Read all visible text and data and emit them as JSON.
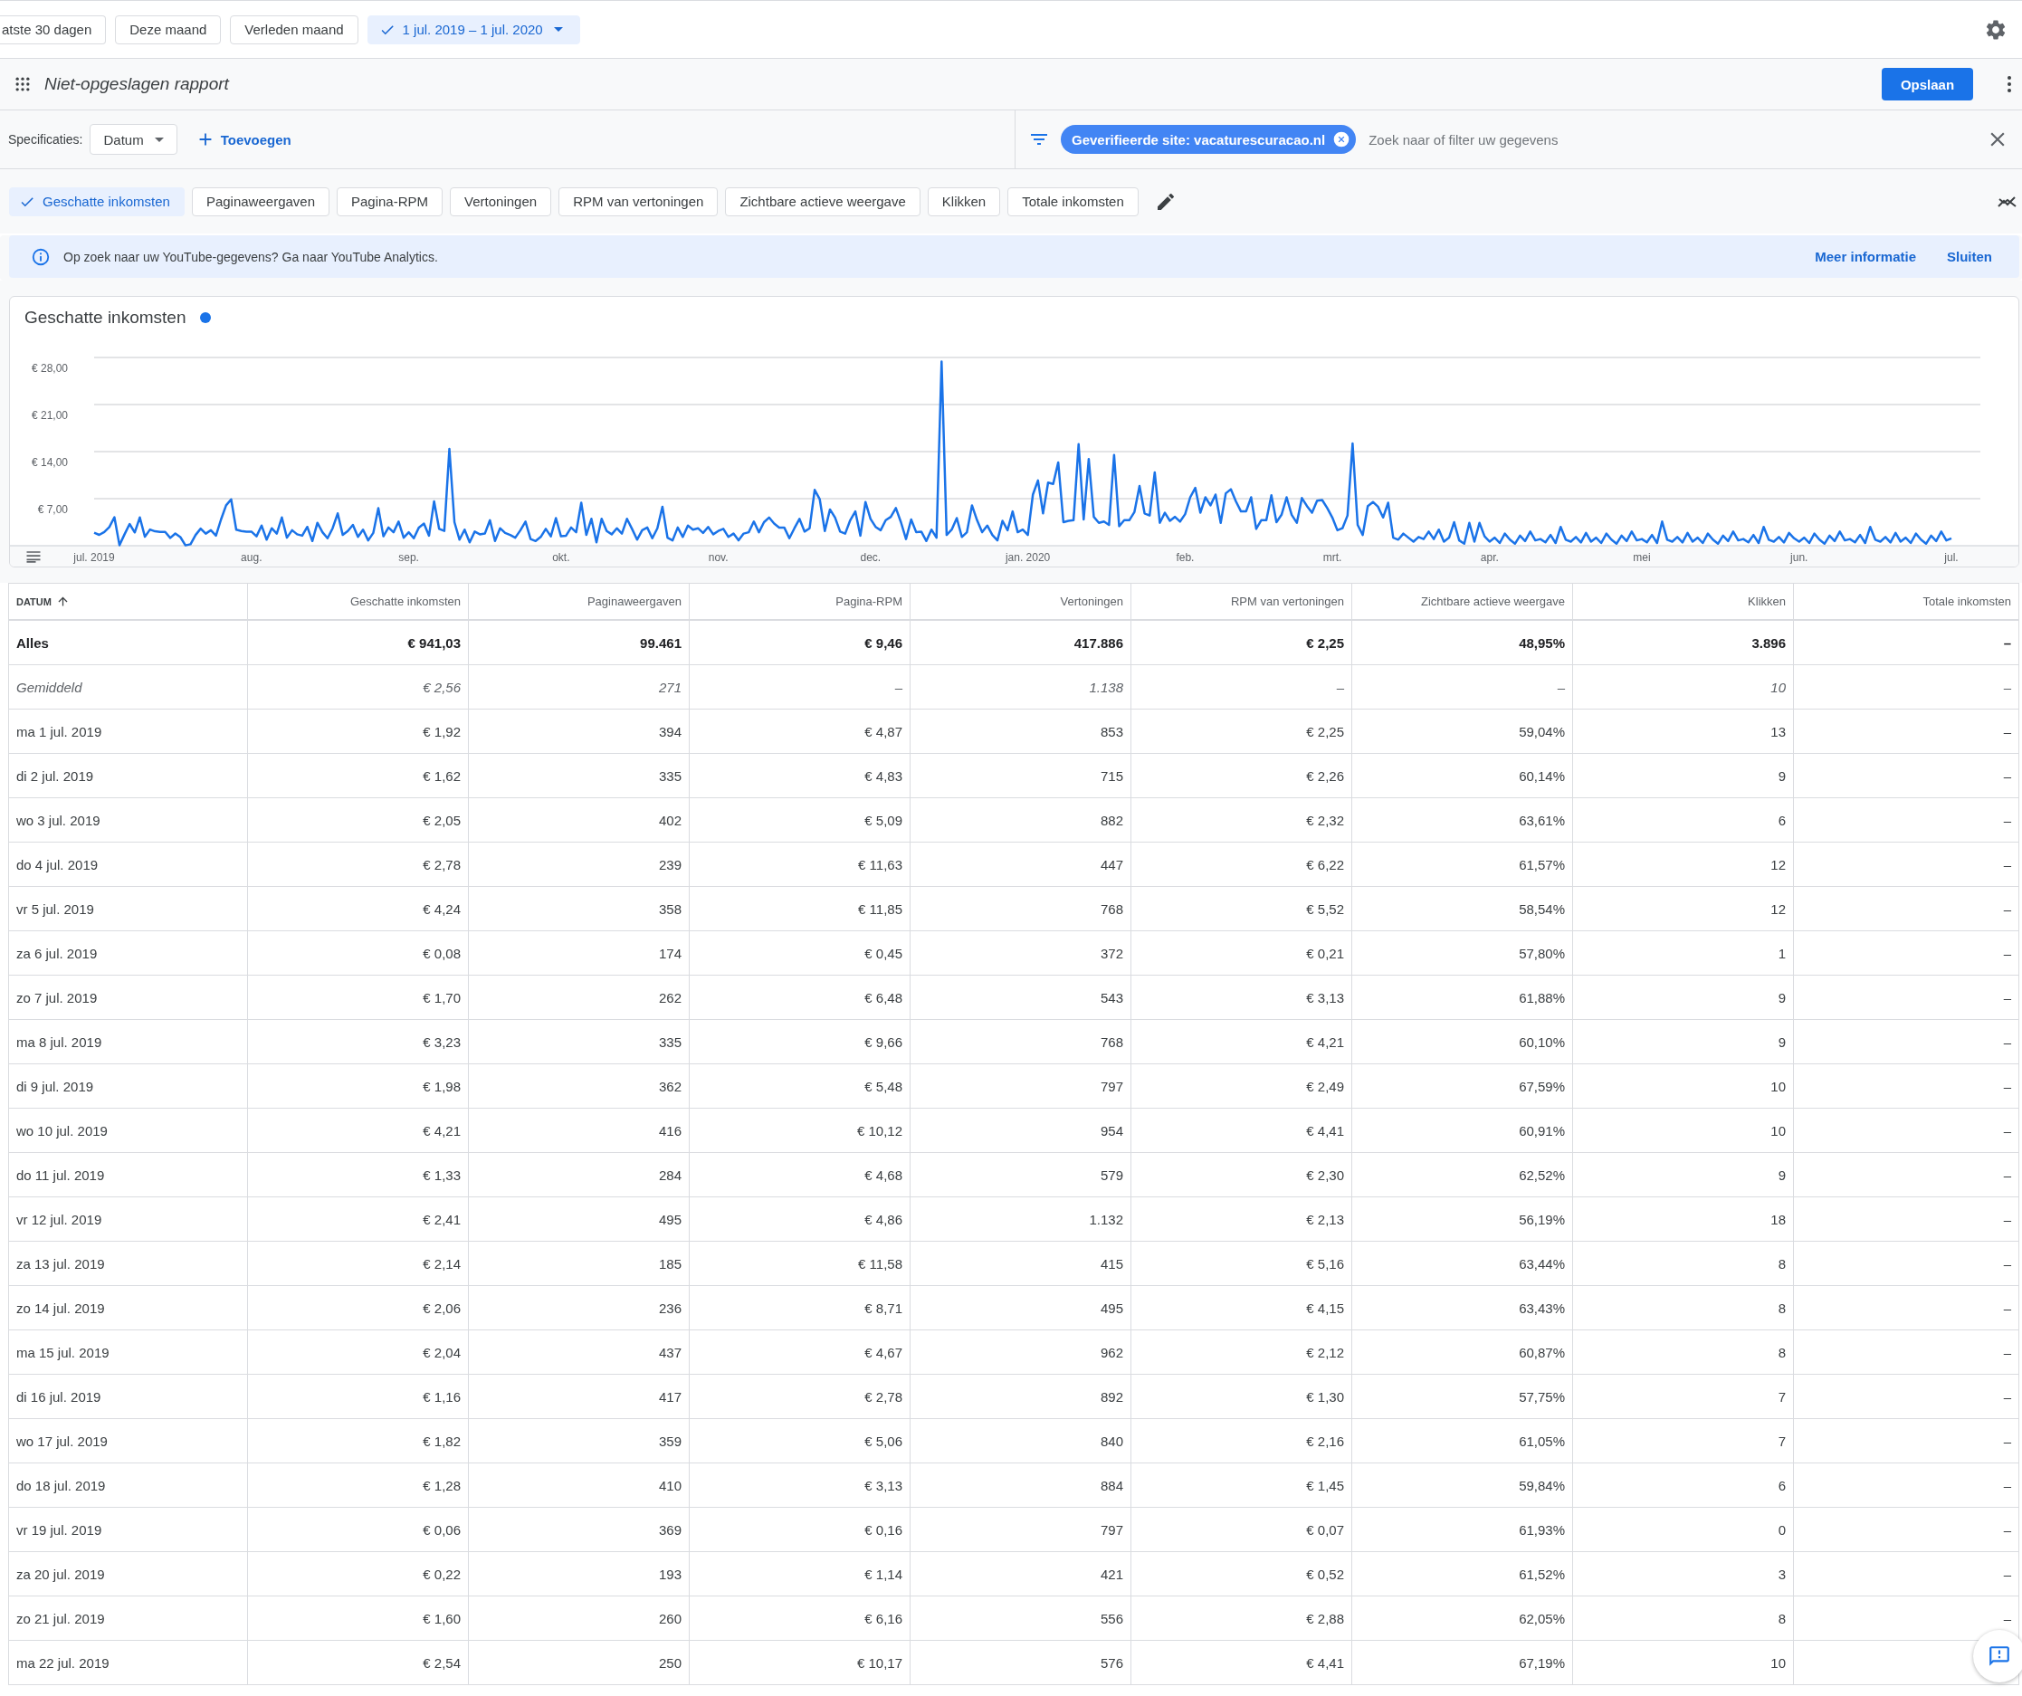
{
  "date_presets": [
    {
      "label": "atste 30 dagen",
      "selected": false
    },
    {
      "label": "Deze maand",
      "selected": false
    },
    {
      "label": "Verleden maand",
      "selected": false
    },
    {
      "label": "1 jul. 2019 – 1 jul. 2020",
      "selected": true
    }
  ],
  "report": {
    "title": "Niet-opgeslagen rapport",
    "save_button": "Opslaan"
  },
  "dimensions": {
    "label": "Specificaties:",
    "value": "Datum",
    "add_button": "Toevoegen"
  },
  "filter": {
    "chips": [
      {
        "label": "Geverifieerde site: vacaturescuracao.nl"
      }
    ],
    "placeholder": "Zoek naar of filter uw gegevens"
  },
  "metrics": [
    {
      "label": "Geschatte inkomsten",
      "selected": true
    },
    {
      "label": "Paginaweergaven",
      "selected": false
    },
    {
      "label": "Pagina-RPM",
      "selected": false
    },
    {
      "label": "Vertoningen",
      "selected": false
    },
    {
      "label": "RPM van vertoningen",
      "selected": false
    },
    {
      "label": "Zichtbare actieve weergave",
      "selected": false
    },
    {
      "label": "Klikken",
      "selected": false
    },
    {
      "label": "Totale inkomsten",
      "selected": false
    }
  ],
  "banner": {
    "text": "Op zoek naar uw YouTube-gegevens? Ga naar YouTube Analytics.",
    "links": [
      "Meer informatie",
      "Sluiten"
    ]
  },
  "chart": {
    "chart_data": {
      "type": "line",
      "ylim": [
        0,
        28
      ],
      "grid": true,
      "categories": [
        "jul. 2019",
        null,
        null,
        null,
        null,
        null,
        null,
        null,
        null,
        null,
        null,
        null,
        null,
        null,
        null,
        null,
        null,
        null,
        null,
        null,
        null,
        null,
        null,
        null,
        null,
        null,
        null,
        null,
        null,
        null,
        null,
        "aug.",
        null,
        null,
        null,
        null,
        null,
        null,
        null,
        null,
        null,
        null,
        null,
        null,
        null,
        null,
        null,
        null,
        null,
        null,
        null,
        null,
        null,
        null,
        null,
        null,
        null,
        null,
        null,
        null,
        null,
        null,
        "sep.",
        null,
        null,
        null,
        null,
        null,
        null,
        null,
        null,
        null,
        null,
        null,
        null,
        null,
        null,
        null,
        null,
        null,
        null,
        null,
        null,
        null,
        null,
        null,
        null,
        null,
        null,
        null,
        null,
        null,
        "okt.",
        null,
        null,
        null,
        null,
        null,
        null,
        null,
        null,
        null,
        null,
        null,
        null,
        null,
        null,
        null,
        null,
        null,
        null,
        null,
        null,
        null,
        null,
        null,
        null,
        null,
        null,
        null,
        null,
        null,
        null,
        "nov.",
        null,
        null,
        null,
        null,
        null,
        null,
        null,
        null,
        null,
        null,
        null,
        null,
        null,
        null,
        null,
        null,
        null,
        null,
        null,
        null,
        null,
        null,
        null,
        null,
        null,
        null,
        null,
        null,
        null,
        "dec.",
        null,
        null,
        null,
        null,
        null,
        null,
        null,
        null,
        null,
        null,
        null,
        null,
        null,
        null,
        null,
        null,
        null,
        null,
        null,
        null,
        null,
        null,
        null,
        null,
        null,
        null,
        null,
        null,
        null,
        null,
        "jan. 2020",
        null,
        null,
        null,
        null,
        null,
        null,
        null,
        null,
        null,
        null,
        null,
        null,
        null,
        null,
        null,
        null,
        null,
        null,
        null,
        null,
        null,
        null,
        null,
        null,
        null,
        null,
        null,
        null,
        null,
        null,
        "feb.",
        null,
        null,
        null,
        null,
        null,
        null,
        null,
        null,
        null,
        null,
        null,
        null,
        null,
        null,
        null,
        null,
        null,
        null,
        null,
        null,
        null,
        null,
        null,
        null,
        null,
        null,
        null,
        null,
        "mrt.",
        null,
        null,
        null,
        null,
        null,
        null,
        null,
        null,
        null,
        null,
        null,
        null,
        null,
        null,
        null,
        null,
        null,
        null,
        null,
        null,
        null,
        null,
        null,
        null,
        null,
        null,
        null,
        null,
        null,
        null,
        "apr.",
        null,
        null,
        null,
        null,
        null,
        null,
        null,
        null,
        null,
        null,
        null,
        null,
        null,
        null,
        null,
        null,
        null,
        null,
        null,
        null,
        null,
        null,
        null,
        null,
        null,
        null,
        null,
        null,
        null,
        "mei",
        null,
        null,
        null,
        null,
        null,
        null,
        null,
        null,
        null,
        null,
        null,
        null,
        null,
        null,
        null,
        null,
        null,
        null,
        null,
        null,
        null,
        null,
        null,
        null,
        null,
        null,
        null,
        null,
        null,
        null,
        "jun.",
        null,
        null,
        null,
        null,
        null,
        null,
        null,
        null,
        null,
        null,
        null,
        null,
        null,
        null,
        null,
        null,
        null,
        null,
        null,
        null,
        null,
        null,
        null,
        null,
        null,
        null,
        null,
        null,
        null,
        "jul."
      ],
      "yticks": [
        {
          "value": 7,
          "label": "€ 7,00"
        },
        {
          "value": 14,
          "label": "€ 14,00"
        },
        {
          "value": 21,
          "label": "€ 21,00"
        },
        {
          "value": 28,
          "label": "€ 28,00"
        }
      ],
      "series": [
        {
          "name": "Geschatte inkomsten",
          "color": "#1a73e8",
          "values": [
            1.92,
            1.62,
            2.05,
            2.78,
            4.24,
            0.08,
            1.7,
            3.23,
            1.98,
            4.21,
            1.33,
            2.41,
            2.14,
            2.06,
            2.04,
            1.16,
            1.82,
            1.28,
            0.06,
            0.22,
            1.6,
            2.54,
            1.8,
            2.3,
            1.5,
            3.9,
            6.0,
            6.9,
            2.4,
            2.2,
            2.1,
            2.1,
            1.4,
            3.0,
            0.9,
            2.6,
            1.8,
            4.2,
            1.2,
            2.3,
            1.7,
            1.5,
            2.8,
            0.7,
            3.4,
            2.0,
            1.1,
            2.6,
            4.8,
            1.6,
            2.2,
            3.1,
            1.3,
            2.4,
            0.8,
            1.9,
            5.6,
            1.4,
            2.7,
            2.0,
            3.6,
            1.2,
            2.0,
            1.1,
            2.7,
            3.3,
            1.5,
            6.6,
            2.5,
            2.2,
            14.4,
            3.5,
            0.9,
            2.4,
            0.5,
            2.1,
            1.7,
            1.8,
            3.8,
            0.7,
            2.6,
            1.9,
            1.6,
            1.2,
            2.3,
            3.6,
            1.0,
            0.7,
            1.3,
            2.5,
            1.4,
            4.1,
            1.4,
            1.5,
            2.7,
            2.0,
            6.4,
            1.6,
            4.0,
            0.5,
            4.0,
            2.2,
            1.7,
            2.6,
            1.8,
            4.0,
            2.5,
            0.9,
            2.3,
            2.7,
            1.1,
            2.6,
            5.8,
            1.2,
            0.8,
            2.7,
            1.3,
            3.0,
            2.4,
            2.6,
            1.9,
            2.8,
            1.7,
            2.2,
            2.5,
            1.3,
            1.8,
            0.8,
            1.8,
            2.0,
            3.6,
            2.0,
            3.5,
            4.2,
            3.3,
            2.7,
            2.7,
            1.1,
            2.6,
            4.0,
            2.1,
            2.6,
            8.3,
            6.9,
            2.2,
            5.4,
            4.2,
            2.1,
            1.8,
            3.8,
            5.1,
            1.5,
            6.5,
            4.0,
            2.8,
            2.3,
            3.8,
            4.3,
            5.6,
            3.5,
            1.0,
            3.9,
            2.0,
            2.1,
            0.7,
            2.4,
            1.2,
            27.4,
            1.6,
            2.4,
            4.1,
            1.3,
            2.0,
            6.0,
            3.8,
            2.0,
            3.0,
            1.6,
            0.8,
            3.7,
            2.3,
            5.1,
            2.0,
            2.4,
            1.6,
            7.6,
            9.7,
            4.8,
            9.4,
            9.2,
            12.4,
            3.5,
            3.7,
            3.8,
            15.1,
            3.9,
            12.9,
            4.3,
            3.4,
            3.6,
            3.1,
            13.5,
            2.9,
            3.8,
            3.8,
            5.0,
            8.9,
            4.8,
            4.5,
            10.9,
            3.4,
            4.9,
            3.7,
            4.3,
            3.6,
            4.7,
            7.2,
            8.6,
            4.9,
            7.2,
            6.0,
            7.6,
            3.4,
            7.8,
            8.4,
            6.6,
            5.1,
            5.1,
            7.2,
            2.5,
            3.8,
            3.8,
            7.5,
            3.5,
            4.6,
            7.2,
            4.6,
            3.4,
            7.1,
            5.9,
            4.9,
            6.7,
            6.8,
            5.6,
            4.2,
            2.3,
            2.6,
            4.5,
            15.2,
            3.1,
            1.6,
            5.9,
            6.5,
            5.8,
            4.2,
            6.4,
            1.2,
            0.9,
            1.8,
            1.2,
            0.6,
            1.3,
            1.0,
            2.1,
            1.0,
            2.4,
            0.6,
            1.2,
            3.5,
            0.8,
            0.3,
            3.4,
            0.6,
            3.4,
            1.4,
            0.6,
            1.2,
            0.4,
            1.8,
            0.9,
            0.3,
            1.5,
            0.7,
            2.1,
            0.8,
            1.0,
            0.5,
            1.6,
            0.4,
            2.8,
            0.9,
            0.6,
            1.3,
            0.5,
            1.9,
            0.6,
            1.2,
            0.4,
            1.8,
            0.9,
            0.3,
            1.5,
            0.7,
            2.1,
            0.8,
            1.0,
            0.5,
            1.6,
            0.4,
            3.6,
            0.9,
            0.6,
            1.3,
            0.5,
            1.9,
            0.6,
            1.2,
            0.4,
            1.8,
            0.9,
            0.3,
            1.5,
            0.7,
            2.1,
            0.8,
            1.0,
            0.5,
            1.6,
            0.4,
            2.8,
            0.9,
            0.6,
            1.3,
            0.5,
            1.9,
            1.1,
            0.6,
            1.2,
            0.4,
            1.8,
            0.9,
            0.3,
            1.5,
            0.7,
            2.1,
            0.8,
            1.0,
            0.5,
            1.6,
            0.4,
            2.8,
            0.9,
            0.6,
            1.3,
            0.5,
            1.9,
            0.6,
            1.2,
            0.4,
            1.8,
            0.9,
            0.3,
            1.5,
            0.7,
            2.1,
            0.8,
            1.1
          ]
        }
      ]
    }
  },
  "table": {
    "columns": [
      {
        "label": "DATUM",
        "sorted_ascending": true
      },
      {
        "label": "Geschatte inkomsten"
      },
      {
        "label": "Paginaweergaven"
      },
      {
        "label": "Pagina-RPM"
      },
      {
        "label": "Vertoningen"
      },
      {
        "label": "RPM van vertoningen"
      },
      {
        "label": "Zichtbare actieve weergave"
      },
      {
        "label": "Klikken"
      },
      {
        "label": "Totale inkomsten"
      }
    ],
    "rows": [
      {
        "kind": "total",
        "cells": [
          "Alles",
          "€ 941,03",
          "99.461",
          "€ 9,46",
          "417.886",
          "€ 2,25",
          "48,95%",
          "3.896",
          "–"
        ]
      },
      {
        "kind": "average",
        "cells": [
          "Gemiddeld",
          "€ 2,56",
          "271",
          "–",
          "1.138",
          "–",
          "–",
          "10",
          "–"
        ]
      },
      {
        "kind": "day",
        "cells": [
          "ma 1 jul. 2019",
          "€ 1,92",
          "394",
          "€ 4,87",
          "853",
          "€ 2,25",
          "59,04%",
          "13",
          "–"
        ]
      },
      {
        "kind": "day",
        "cells": [
          "di 2 jul. 2019",
          "€ 1,62",
          "335",
          "€ 4,83",
          "715",
          "€ 2,26",
          "60,14%",
          "9",
          "–"
        ]
      },
      {
        "kind": "day",
        "cells": [
          "wo 3 jul. 2019",
          "€ 2,05",
          "402",
          "€ 5,09",
          "882",
          "€ 2,32",
          "63,61%",
          "6",
          "–"
        ]
      },
      {
        "kind": "day",
        "cells": [
          "do 4 jul. 2019",
          "€ 2,78",
          "239",
          "€ 11,63",
          "447",
          "€ 6,22",
          "61,57%",
          "12",
          "–"
        ]
      },
      {
        "kind": "day",
        "cells": [
          "vr 5 jul. 2019",
          "€ 4,24",
          "358",
          "€ 11,85",
          "768",
          "€ 5,52",
          "58,54%",
          "12",
          "–"
        ]
      },
      {
        "kind": "day",
        "cells": [
          "za 6 jul. 2019",
          "€ 0,08",
          "174",
          "€ 0,45",
          "372",
          "€ 0,21",
          "57,80%",
          "1",
          "–"
        ]
      },
      {
        "kind": "day",
        "cells": [
          "zo 7 jul. 2019",
          "€ 1,70",
          "262",
          "€ 6,48",
          "543",
          "€ 3,13",
          "61,88%",
          "9",
          "–"
        ]
      },
      {
        "kind": "day",
        "cells": [
          "ma 8 jul. 2019",
          "€ 3,23",
          "335",
          "€ 9,66",
          "768",
          "€ 4,21",
          "60,10%",
          "9",
          "–"
        ]
      },
      {
        "kind": "day",
        "cells": [
          "di 9 jul. 2019",
          "€ 1,98",
          "362",
          "€ 5,48",
          "797",
          "€ 2,49",
          "67,59%",
          "10",
          "–"
        ]
      },
      {
        "kind": "day",
        "cells": [
          "wo 10 jul. 2019",
          "€ 4,21",
          "416",
          "€ 10,12",
          "954",
          "€ 4,41",
          "60,91%",
          "10",
          "–"
        ]
      },
      {
        "kind": "day",
        "cells": [
          "do 11 jul. 2019",
          "€ 1,33",
          "284",
          "€ 4,68",
          "579",
          "€ 2,30",
          "62,52%",
          "9",
          "–"
        ]
      },
      {
        "kind": "day",
        "cells": [
          "vr 12 jul. 2019",
          "€ 2,41",
          "495",
          "€ 4,86",
          "1.132",
          "€ 2,13",
          "56,19%",
          "18",
          "–"
        ]
      },
      {
        "kind": "day",
        "cells": [
          "za 13 jul. 2019",
          "€ 2,14",
          "185",
          "€ 11,58",
          "415",
          "€ 5,16",
          "63,44%",
          "8",
          "–"
        ]
      },
      {
        "kind": "day",
        "cells": [
          "zo 14 jul. 2019",
          "€ 2,06",
          "236",
          "€ 8,71",
          "495",
          "€ 4,15",
          "63,43%",
          "8",
          "–"
        ]
      },
      {
        "kind": "day",
        "cells": [
          "ma 15 jul. 2019",
          "€ 2,04",
          "437",
          "€ 4,67",
          "962",
          "€ 2,12",
          "60,87%",
          "8",
          "–"
        ]
      },
      {
        "kind": "day",
        "cells": [
          "di 16 jul. 2019",
          "€ 1,16",
          "417",
          "€ 2,78",
          "892",
          "€ 1,30",
          "57,75%",
          "7",
          "–"
        ]
      },
      {
        "kind": "day",
        "cells": [
          "wo 17 jul. 2019",
          "€ 1,82",
          "359",
          "€ 5,06",
          "840",
          "€ 2,16",
          "61,05%",
          "7",
          "–"
        ]
      },
      {
        "kind": "day",
        "cells": [
          "do 18 jul. 2019",
          "€ 1,28",
          "410",
          "€ 3,13",
          "884",
          "€ 1,45",
          "59,84%",
          "6",
          "–"
        ]
      },
      {
        "kind": "day",
        "cells": [
          "vr 19 jul. 2019",
          "€ 0,06",
          "369",
          "€ 0,16",
          "797",
          "€ 0,07",
          "61,93%",
          "0",
          "–"
        ]
      },
      {
        "kind": "day",
        "cells": [
          "za 20 jul. 2019",
          "€ 0,22",
          "193",
          "€ 1,14",
          "421",
          "€ 0,52",
          "61,52%",
          "3",
          "–"
        ]
      },
      {
        "kind": "day",
        "cells": [
          "zo 21 jul. 2019",
          "€ 1,60",
          "260",
          "€ 6,16",
          "556",
          "€ 2,88",
          "62,05%",
          "8",
          "–"
        ]
      },
      {
        "kind": "day",
        "cells": [
          "ma 22 jul. 2019",
          "€ 2,54",
          "250",
          "€ 10,17",
          "576",
          "€ 4,41",
          "67,19%",
          "10"
        ]
      }
    ]
  }
}
